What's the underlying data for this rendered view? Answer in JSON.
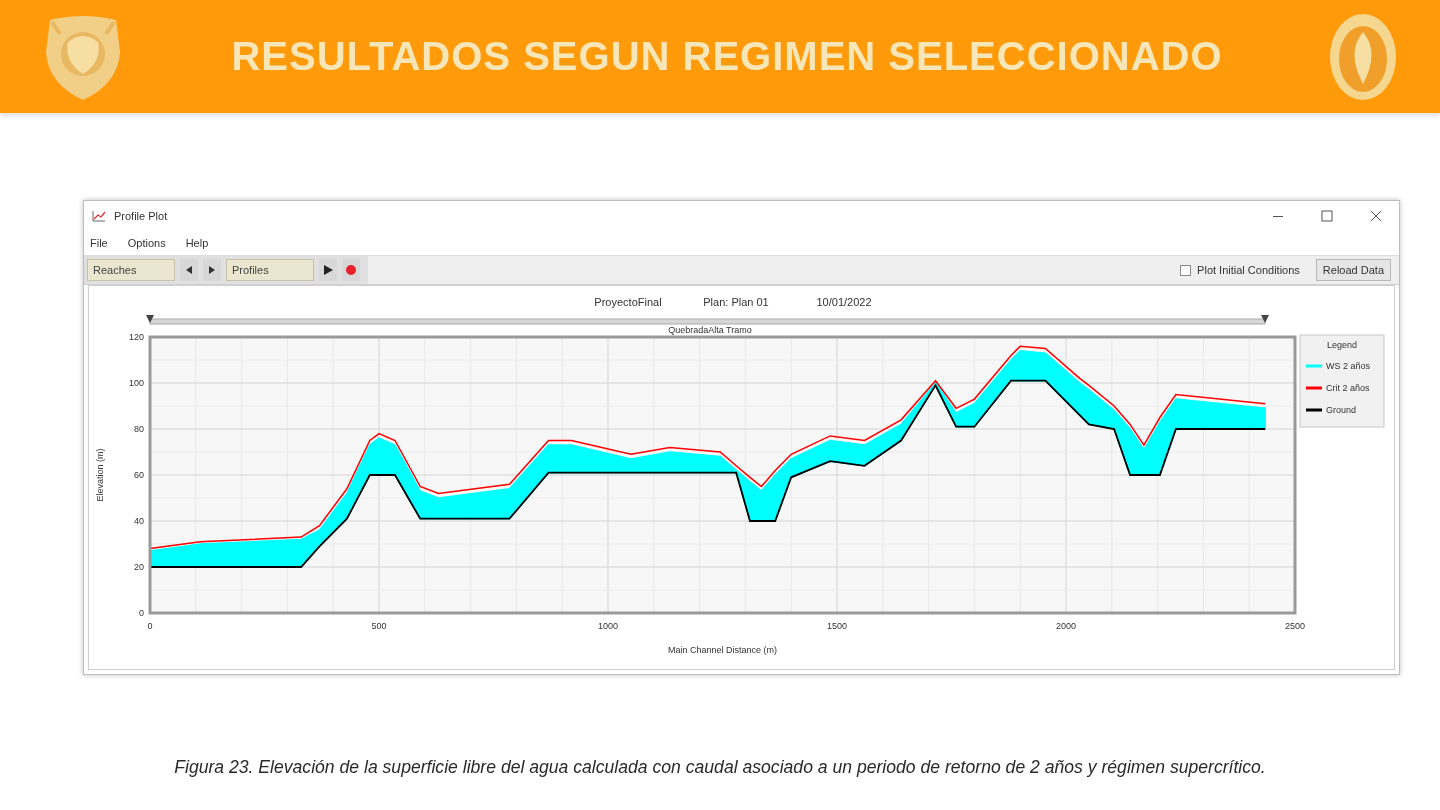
{
  "header": {
    "title": "RESULTADOS SEGUN REGIMEN SELECCIONADO"
  },
  "window": {
    "title": "Profile Plot",
    "menu": [
      "File",
      "Options",
      "Help"
    ],
    "toolbar": {
      "reaches_button": "Reaches",
      "profiles_button": "Profiles",
      "checkbox": {
        "label": "Plot Initial Conditions",
        "checked": false
      },
      "reload_button": "Reload Data"
    }
  },
  "plot": {
    "heading": [
      "ProyectoFinal",
      "Plan: Plan 01",
      "10/01/2022"
    ],
    "reach": "QuebradaAlta Tramo",
    "chart_data": {
      "type": "area",
      "xlabel": "Main Channel Distance (m)",
      "ylabel": "Elevation (m)",
      "x": [
        0,
        110,
        330,
        370,
        430,
        480,
        500,
        535,
        590,
        630,
        785,
        870,
        920,
        1050,
        1135,
        1245,
        1280,
        1310,
        1335,
        1365,
        1400,
        1485,
        1560,
        1640,
        1715,
        1760,
        1800,
        1880,
        1900,
        1955,
        2030,
        2050,
        2105,
        2140,
        2170,
        2205,
        2240,
        2435
      ],
      "series": [
        {
          "name": "WS 2 años",
          "type": "area",
          "color": "#00ffff",
          "values": [
            27,
            30,
            32,
            36,
            52,
            73,
            76,
            73,
            53,
            50,
            54,
            73,
            73,
            67,
            70,
            68,
            62,
            57,
            53,
            60,
            67,
            75,
            73,
            82,
            100,
            87,
            91,
            110,
            114,
            113,
            100,
            97,
            88,
            80,
            71,
            83,
            93,
            89
          ]
        },
        {
          "name": "Crit 2 años",
          "type": "line",
          "color": "#ff0000",
          "values": [
            28,
            31,
            33,
            38,
            54,
            75,
            78,
            75,
            55,
            52,
            56,
            75,
            75,
            69,
            72,
            70,
            64,
            59,
            55,
            62,
            69,
            77,
            75,
            84,
            101,
            89,
            93,
            112,
            116,
            115,
            102,
            99,
            90,
            82,
            73,
            85,
            95,
            91
          ]
        },
        {
          "name": "Ground",
          "type": "line",
          "color": "#000000",
          "values": [
            20,
            20,
            20,
            29,
            41,
            60,
            60,
            60,
            41,
            41,
            41,
            61,
            61,
            61,
            61,
            61,
            61,
            40,
            40,
            40,
            59,
            66,
            64,
            75,
            99,
            81,
            81,
            101,
            101,
            101,
            86,
            82,
            80,
            60,
            60,
            60,
            80,
            80
          ]
        }
      ],
      "xlim": [
        0,
        2500
      ],
      "ylim": [
        0,
        120
      ],
      "xticks": [
        0,
        500,
        1000,
        1500,
        2000,
        2500
      ],
      "yticks": [
        0,
        20,
        40,
        60,
        80,
        100,
        120
      ],
      "grid": true,
      "legend": {
        "title": "Legend"
      }
    }
  },
  "caption": "Figura 23. Elevación de la superficie libre del agua calculada con caudal asociado a un periodo de retorno de 2 años y régimen supercrítico."
}
